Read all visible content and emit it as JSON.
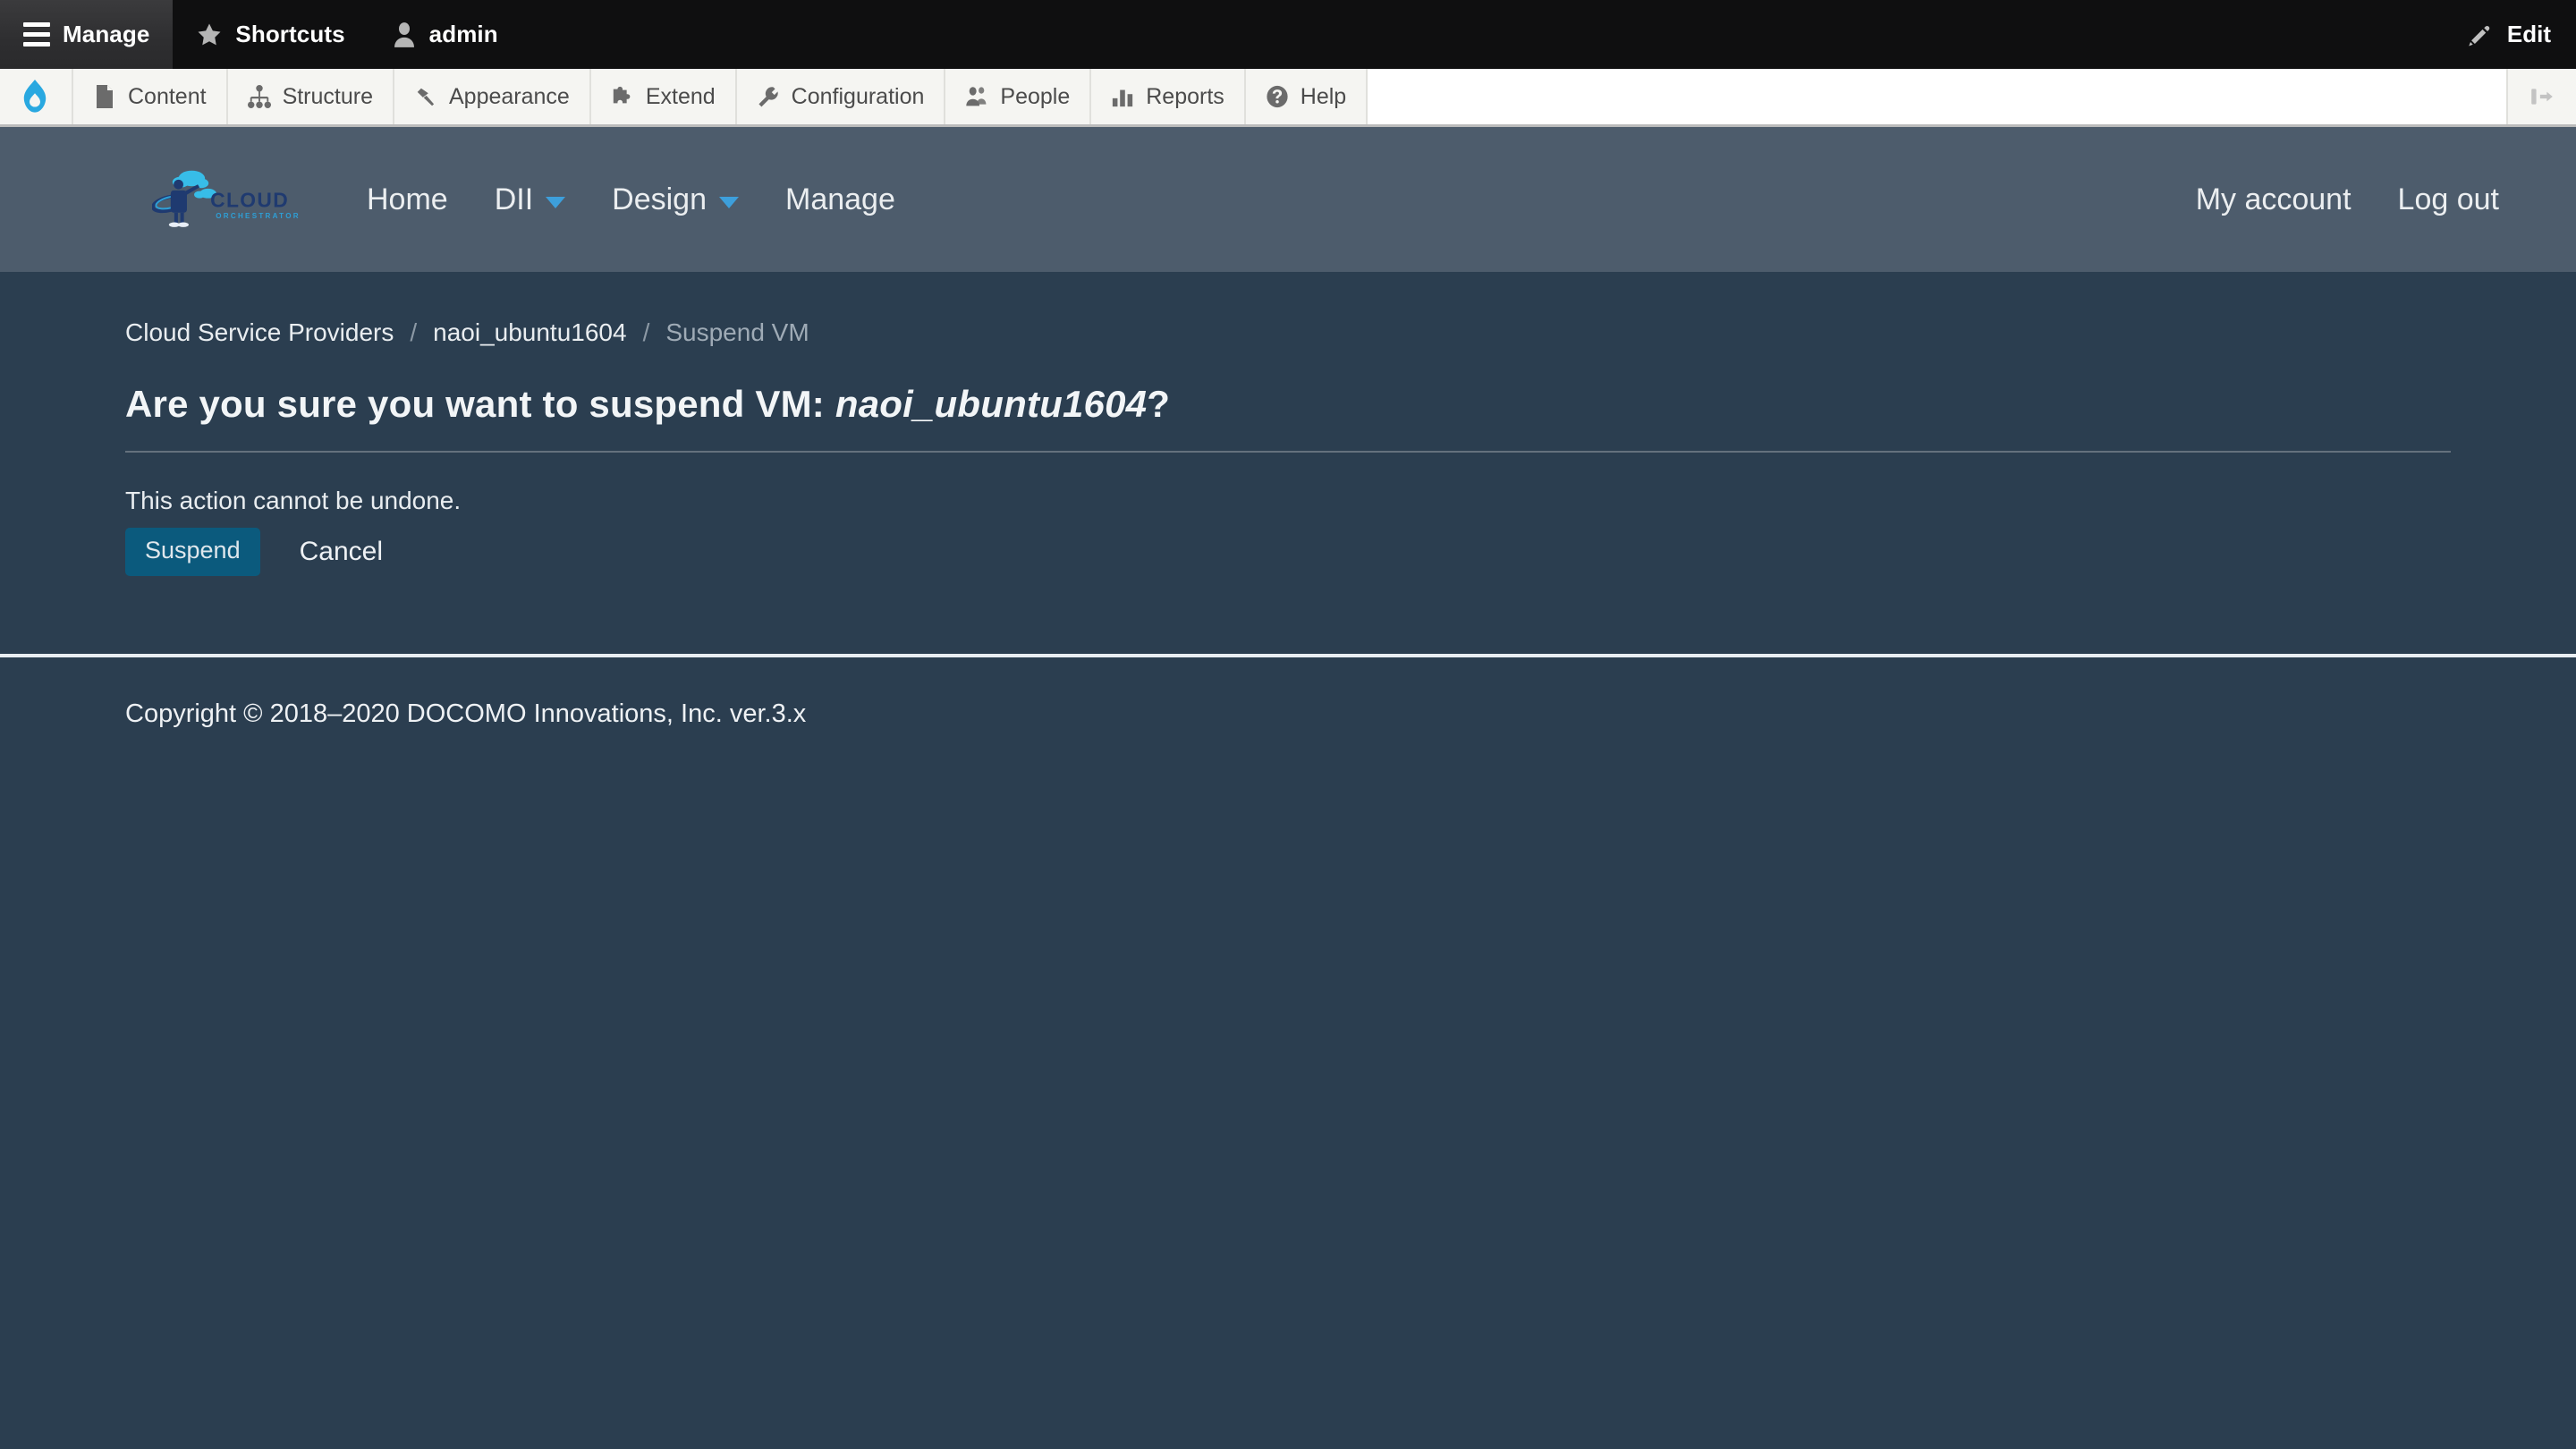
{
  "admin_toolbar": {
    "manage_label": "Manage",
    "shortcuts_label": "Shortcuts",
    "user_label": "admin",
    "edit_label": "Edit"
  },
  "admin_menu": {
    "items": [
      {
        "label": "Content",
        "icon": "document-icon"
      },
      {
        "label": "Structure",
        "icon": "structure-icon"
      },
      {
        "label": "Appearance",
        "icon": "paintbrush-icon"
      },
      {
        "label": "Extend",
        "icon": "puzzle-icon"
      },
      {
        "label": "Configuration",
        "icon": "wrench-icon"
      },
      {
        "label": "People",
        "icon": "people-icon"
      },
      {
        "label": "Reports",
        "icon": "bar-chart-icon"
      },
      {
        "label": "Help",
        "icon": "question-mark-icon"
      }
    ]
  },
  "site_header": {
    "logo": {
      "primary_text": "CLOUD",
      "secondary_text": "ORCHESTRATOR"
    },
    "nav": [
      {
        "label": "Home",
        "has_dropdown": false
      },
      {
        "label": "DII",
        "has_dropdown": true
      },
      {
        "label": "Design",
        "has_dropdown": true
      },
      {
        "label": "Manage",
        "has_dropdown": false
      }
    ],
    "account_label": "My account",
    "logout_label": "Log out"
  },
  "breadcrumb": {
    "items": [
      {
        "label": "Cloud Service Providers",
        "current": false
      },
      {
        "label": "naoi_ubuntu1604",
        "current": false
      },
      {
        "label": "Suspend VM",
        "current": true
      }
    ],
    "separator": "/"
  },
  "main": {
    "title_prefix": "Are you sure you want to suspend VM: ",
    "title_vm_name": "naoi_ubuntu1604",
    "title_suffix": "?",
    "help_text": "This action cannot be undone.",
    "submit_label": "Suspend",
    "cancel_label": "Cancel"
  },
  "footer": {
    "copyright": "Copyright © 2018–2020 DOCOMO Innovations, Inc. ver.3.x"
  },
  "colors": {
    "toolbar_bg": "#0f0f10",
    "admin_menu_bg": "#f5f5f2",
    "header_bg": "#4d5c6c",
    "body_bg": "#2b3e50",
    "accent": "#0b5a7d",
    "drupal_blue": "#29a8e0",
    "caret_blue": "#3d9fdb"
  }
}
